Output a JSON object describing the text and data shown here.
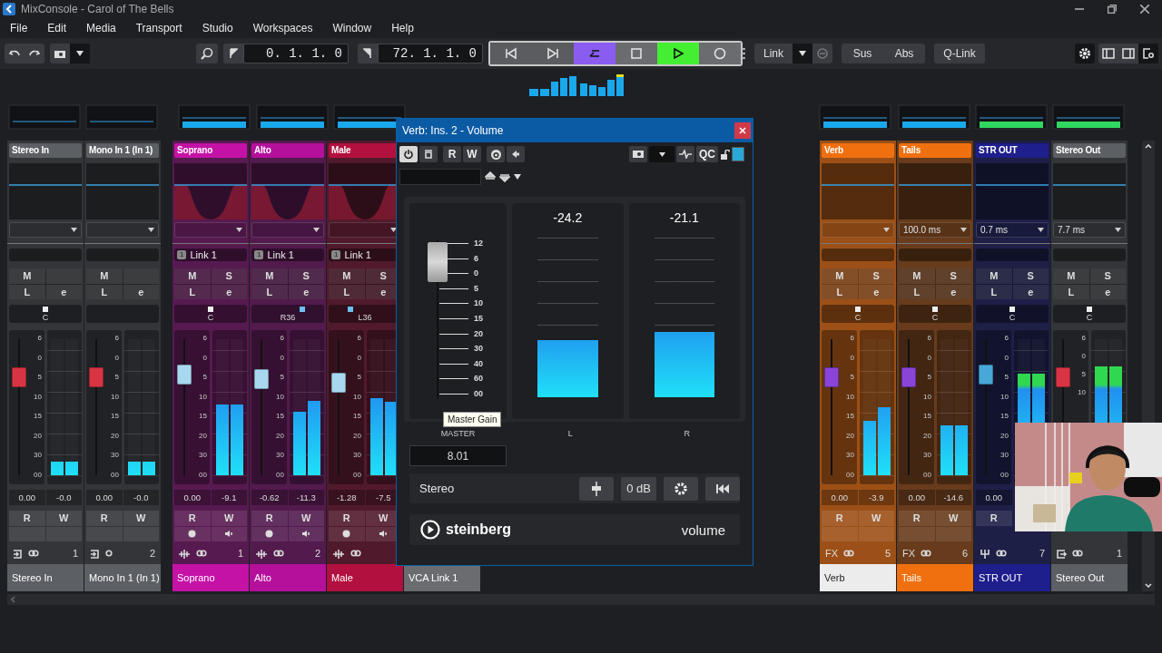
{
  "window": {
    "title": "MixConsole - Carol of The Bells"
  },
  "menu": [
    "File",
    "Edit",
    "Media",
    "Transport",
    "Studio",
    "Workspaces",
    "Window",
    "Help"
  ],
  "toolbar": {
    "left_locator": "0. 1. 1. 0",
    "right_locator": "72. 1. 1. 0",
    "transport": [
      {
        "kind": "prev",
        "on": false
      },
      {
        "kind": "next",
        "on": false
      },
      {
        "kind": "cycle",
        "on": true
      },
      {
        "kind": "stop",
        "on": false
      },
      {
        "kind": "play",
        "on": true
      },
      {
        "kind": "record",
        "on": false
      }
    ],
    "link": "Link",
    "sus": "Sus",
    "abs": "Abs",
    "qlink": "Q-Link"
  },
  "strips": [
    {
      "kind": "input",
      "label_top": "Stereo In",
      "color": "#5c5f63",
      "selected": false,
      "stereo": true,
      "buttons": {
        "mute": "M",
        "listen": "L",
        "edit": "e"
      },
      "pan": {
        "label": "C",
        "level": 0.5
      },
      "scale": [
        "6",
        "0",
        "5",
        "10",
        "15",
        "20",
        "30",
        "00"
      ],
      "fader": {
        "level": 0.72,
        "color": "#d83444"
      },
      "meter": [
        {
          "level": 0.1
        },
        {
          "level": 0.1
        }
      ],
      "gain": "0.00",
      "peak": "-0.0",
      "read": "R",
      "write": "W",
      "number": "1",
      "label_bottom": "Stereo In"
    },
    {
      "kind": "input",
      "label_top": "Mono In 1 (In 1)",
      "color": "#5c5f63",
      "selected": false,
      "stereo": false,
      "buttons": {
        "mute": "M",
        "listen": "L",
        "edit": "e"
      },
      "scale": [
        "6",
        "0",
        "5",
        "10",
        "15",
        "20",
        "30",
        "00"
      ],
      "fader": {
        "level": 0.72,
        "color": "#d83444"
      },
      "meter": [
        {
          "level": 0.1
        },
        {
          "level": 0.1
        }
      ],
      "gain": "0.00",
      "peak": "-0.0",
      "read": "R",
      "write": "W",
      "number": "2",
      "label_bottom": "Mono In 1 (In 1)"
    },
    {
      "kind": "audio",
      "label_top": "Soprano",
      "color": "#c412a6",
      "selected": false,
      "stereo": true,
      "vca": {
        "number": "1",
        "label": "Link 1"
      },
      "buttons": {
        "mute": "M",
        "solo": "S",
        "listen": "L",
        "edit": "e"
      },
      "pan": {
        "label": "C",
        "level": 0.5
      },
      "scale": [
        "6",
        "0",
        "5",
        "10",
        "15",
        "20",
        "30",
        "00"
      ],
      "fader": {
        "level": 0.74,
        "color": "#a8d8f0"
      },
      "meter": [
        {
          "level": 0.52
        },
        {
          "level": 0.52
        }
      ],
      "gain": "0.00",
      "peak": "-9.1",
      "read": "R",
      "write": "W",
      "number": "1",
      "label_bottom": "Soprano"
    },
    {
      "kind": "audio",
      "label_top": "Alto",
      "color": "#b5109c",
      "selected": false,
      "stereo": true,
      "vca": {
        "number": "1",
        "label": "Link 1"
      },
      "buttons": {
        "mute": "M",
        "solo": "S",
        "listen": "L",
        "edit": "e"
      },
      "pan": {
        "label": "R36",
        "level": 0.7
      },
      "scale": [
        "6",
        "0",
        "5",
        "10",
        "15",
        "20",
        "30",
        "00"
      ],
      "fader": {
        "level": 0.71,
        "color": "#a8d8f0"
      },
      "meter": [
        {
          "level": 0.47
        },
        {
          "level": 0.55
        }
      ],
      "gain": "-0.62",
      "peak": "-11.3",
      "read": "R",
      "write": "W",
      "number": "2",
      "label_bottom": "Alto"
    },
    {
      "kind": "audio",
      "label_top": "Male",
      "color": "#b2103e",
      "selected": false,
      "stereo": true,
      "vca": {
        "number": "1",
        "label": "Link 1"
      },
      "buttons": {
        "mute": "M",
        "solo": "S",
        "listen": "L",
        "edit": "e"
      },
      "pan": {
        "label": "L36",
        "level": 0.3
      },
      "scale": [
        "6",
        "0",
        "5",
        "10",
        "15",
        "20",
        "30",
        "00"
      ],
      "fader": {
        "level": 0.68,
        "color": "#a8d8f0"
      },
      "meter": [
        {
          "level": 0.57
        },
        {
          "level": 0.54
        }
      ],
      "gain": "-1.28",
      "peak": "-7.5",
      "read": "R",
      "write": "W",
      "label_bottom": "Male"
    },
    {
      "kind": "vca",
      "color": "#6a6c70",
      "selected": false,
      "label_bottom": "VCA Link 1"
    },
    {
      "kind": "fx",
      "label_top": "Verb",
      "color": "#f07010",
      "selected": true,
      "stereo": true,
      "buttons": {
        "mute": "M",
        "solo": "S",
        "listen": "L",
        "edit": "e"
      },
      "pan": {
        "label": "C",
        "level": 0.5
      },
      "scale": [
        "6",
        "0",
        "5",
        "10",
        "15",
        "20",
        "30",
        "00"
      ],
      "fader": {
        "level": 0.72,
        "color": "#8a44d8"
      },
      "meter": [
        {
          "level": 0.4
        },
        {
          "level": 0.5
        }
      ],
      "gain": "0.00",
      "peak": "-3.9",
      "read": "R",
      "write": "W",
      "route_label": "FX",
      "number": "5",
      "label_bottom": "Verb"
    },
    {
      "kind": "fx",
      "label_top": "Tails",
      "color": "#f07010",
      "selected": false,
      "stereo": true,
      "latency": "100.0 ms",
      "buttons": {
        "mute": "M",
        "solo": "S",
        "listen": "L",
        "edit": "e"
      },
      "pan": {
        "label": "C",
        "level": 0.5
      },
      "scale": [
        "6",
        "0",
        "5",
        "10",
        "15",
        "20",
        "30",
        "00"
      ],
      "fader": {
        "level": 0.72,
        "color": "#8a44d8"
      },
      "meter": [
        {
          "level": 0.37
        },
        {
          "level": 0.37
        }
      ],
      "gain": "0.00",
      "peak": "-14.6",
      "read": "R",
      "write": "W",
      "route_label": "FX",
      "number": "6",
      "label_bottom": "Tails"
    },
    {
      "kind": "group",
      "label_top": "STR OUT",
      "color": "#1e1e8c",
      "selected": false,
      "stereo": true,
      "latency": "0.7 ms",
      "buttons": {
        "mute": "M",
        "solo": "S",
        "listen": "L",
        "edit": "e"
      },
      "pan": {
        "label": "C",
        "level": 0.5
      },
      "scale": [
        "6",
        "0",
        "5",
        "10",
        "15",
        "20",
        "30",
        "00"
      ],
      "fader": {
        "level": 0.74,
        "color": "#48a8d8"
      },
      "meter": [
        {
          "level": 0.75
        },
        {
          "level": 0.75
        }
      ],
      "gain": "0.00",
      "read": "R",
      "number": "7",
      "label_bottom": "STR OUT"
    },
    {
      "kind": "output",
      "label_top": "Stereo Out",
      "color": "#5c5f63",
      "selected": false,
      "stereo": true,
      "latency": "7.7 ms",
      "buttons": {
        "mute": "M",
        "solo": "S",
        "listen": "L",
        "edit": "e"
      },
      "pan": {
        "label": "C",
        "level": 0.5
      },
      "scale": [
        "6",
        "0",
        "5",
        "10"
      ],
      "fader": {
        "level": 0.72,
        "color": "#d83444"
      },
      "meter": [
        {
          "level": 0.8
        },
        {
          "level": 0.8
        }
      ],
      "number": "1",
      "label_bottom": "Stereo Out"
    }
  ],
  "plugin": {
    "title": "Verb: Ins. 2 - Volume",
    "power_on": true,
    "read": "R",
    "write": "W",
    "qc": "QC",
    "master": {
      "scale": [
        "12",
        "6",
        "0",
        "5",
        "10",
        "15",
        "20",
        "30",
        "40",
        "60",
        "00"
      ],
      "level": 0.86,
      "tooltip": "Master Gain",
      "label": "MASTER",
      "value": "8.01"
    },
    "meters": [
      {
        "reading": "-24.2",
        "level": 0.36,
        "label": "L"
      },
      {
        "reading": "-21.1",
        "level": 0.41,
        "label": "R"
      }
    ],
    "channel_mode": "Stereo",
    "gain_button": "0 dB",
    "brand": "steinberg",
    "plugin_name": "volume"
  }
}
